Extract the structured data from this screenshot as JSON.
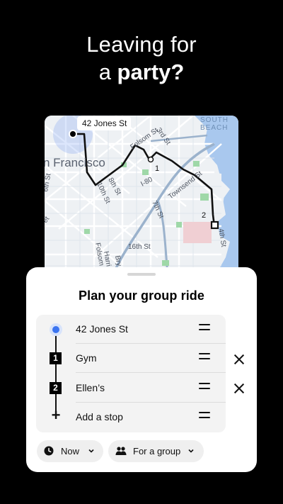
{
  "headline": {
    "line1": "Leaving for",
    "line2_prefix": "a ",
    "line2_bold": "party?"
  },
  "map": {
    "labels": {
      "address_pin": "42 Jones St",
      "area": "n Francisco",
      "south_beach_1": "SOUTH",
      "south_beach_2": "BEACH",
      "third_st": "3rd St",
      "eighth_st": "8th St",
      "tenth_st": "10th St",
      "seventh_st": "7th St",
      "folsom_st_map": "Folsom St",
      "townsend_st": "Townsend St",
      "i80": "I-80",
      "sixteenth_st": "16th St",
      "folsom_st_lower": "Folsom",
      "harri": "Harri",
      "bry": "Bry",
      "sixth_st_left": "6th St",
      "et": "et",
      "fourth_st": "4th St",
      "stop1": "1",
      "stop2": "2"
    }
  },
  "sheet": {
    "title": "Plan your group ride",
    "stops": [
      {
        "label": "42 Jones St",
        "type": "origin"
      },
      {
        "label": "Gym",
        "type": "numbered",
        "number": "1"
      },
      {
        "label": "Ellen’s",
        "type": "numbered",
        "number": "2"
      },
      {
        "label": "Add a stop",
        "type": "add"
      }
    ],
    "when_chip": "Now",
    "who_chip": "For a group"
  },
  "colors": {
    "accent_blue": "#3b74f0",
    "route": "#111111",
    "map_water": "#a9c8ee",
    "map_park": "#9fd8a8"
  }
}
